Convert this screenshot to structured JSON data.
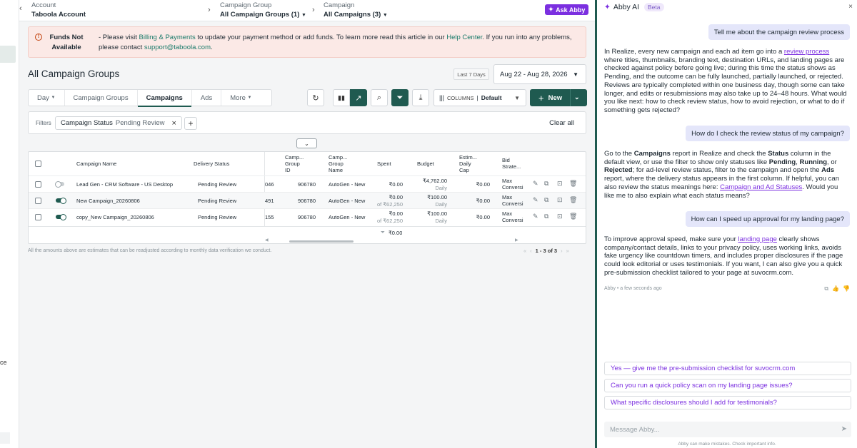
{
  "leftnav": {
    "partial_text": "ce"
  },
  "topbar": {
    "account_label": "Account",
    "account_value": "Taboola Account",
    "group_label": "Campaign Group",
    "group_value": "All Campaign Groups (1)",
    "campaign_label": "Campaign",
    "campaign_value": "All Campaigns (3)",
    "ask_abby": "Ask Abby"
  },
  "alert": {
    "title": "Funds Not Available",
    "msg_pre": "- Please visit ",
    "link1": "Billing & Payments",
    "msg_mid": " to update your payment method or add funds. To learn more read this article in our ",
    "link2": "Help Center",
    "msg_post": ". If you run into any problems, please contact ",
    "link3": "support@taboola.com",
    "msg_end": "."
  },
  "page": {
    "title": "All Campaign Groups",
    "last7": "Last 7 Days",
    "date_range": "Aug 22 - Aug 28, 2026"
  },
  "tabs": [
    "Day",
    "Campaign Groups",
    "Campaigns",
    "Ads",
    "More"
  ],
  "columns": {
    "label": "COLUMNS",
    "value": "Default"
  },
  "new_btn": "New",
  "filters": {
    "label": "Filters",
    "chip_key": "Campaign Status",
    "chip_value": "Pending Review",
    "clear": "Clear all"
  },
  "table": {
    "headers": {
      "name": "Campaign Name",
      "delivery": "Delivery Status",
      "gid": "Camp... Group ID",
      "gname": "Camp... Group Name",
      "spent": "Spent",
      "budget": "Budget",
      "daily": "Estim... Daily Cap",
      "bid": "Bid Strate..."
    },
    "rows": [
      {
        "name": "Lead Gen - CRM Software - US Desktop",
        "delivery": "Pending Review",
        "id": "046",
        "gid": "906780",
        "gname": "AutoGen - New",
        "spent": "₹0.00",
        "spent_sub": "",
        "budget": "₹4,762.00",
        "budget_sub": "Daily",
        "daily": "₹0.00",
        "bid": "Max Conversions"
      },
      {
        "name": "New Campaign_20260806",
        "delivery": "Pending Review",
        "id": "491",
        "gid": "906780",
        "gname": "AutoGen - New",
        "spent": "₹0.00",
        "spent_sub": "of ₹62,250",
        "budget": "₹100.00",
        "budget_sub": "Daily",
        "daily": "₹0.00",
        "bid": "Max Conversions"
      },
      {
        "name": "copy_New Campaign_20260806",
        "delivery": "Pending Review",
        "id": "155",
        "gid": "906780",
        "gname": "AutoGen - New",
        "spent": "₹0.00",
        "spent_sub": "of ₹62,250",
        "budget": "₹100.00",
        "budget_sub": "Daily",
        "daily": "₹0.00",
        "bid": "Max Conversions"
      }
    ],
    "total_spent": "₹0.00"
  },
  "footnote": "All the amounts above are estimates that can be readjusted according to monthly data verification we conduct.",
  "pager": {
    "text": "1 - 3 of 3"
  },
  "chat": {
    "title": "Abby AI",
    "beta": "Beta",
    "u1": "Tell me about the campaign review process",
    "a1_pre": "In Realize, every new campaign and each ad item go into a ",
    "a1_link": "review process",
    "a1_post": " where titles, thumbnails, branding text, destination URLs, and landing pages are checked against policy before going live; during this time the status shows as Pending, and the outcome can be fully launched, partially launched, or rejected. Reviews are typically completed within one business day, though some can take longer, and edits or resubmissions may also take up to 24–48 hours. What would you like next: how to check review status, how to avoid rejection, or what to do if something gets rejected?",
    "u2": "How do I check the review status of my campaign?",
    "a2_1": "Go to the ",
    "a2_b1": "Campaigns",
    "a2_2": " report in Realize and check the ",
    "a2_b2": "Status",
    "a2_3": " column in the default view, or use the filter to show only statuses like ",
    "a2_b3": "Pending",
    "a2_4": ", ",
    "a2_b4": "Running",
    "a2_5": ", or ",
    "a2_b5": "Rejected",
    "a2_6": "; for ad-level review status, filter to the campaign and open the ",
    "a2_b6": "Ads",
    "a2_7": " report, where the delivery status appears in the first column. If helpful, you can also review the status meanings here: ",
    "a2_link": "Campaign and Ad Statuses",
    "a2_8": ". Would you like me to also explain what each status means?",
    "u3": "How can I speed up approval for my landing page?",
    "a3_pre": "To improve approval speed, make sure your ",
    "a3_link": "landing page",
    "a3_post": " clearly shows company/contact details, links to your privacy policy, uses working links, avoids fake urgency like countdown timers, and includes proper disclosures if the page could look editorial or uses testimonials. If you want, I can also give you a quick pre-submission checklist tailored to your page at suvocrm.com.",
    "meta": "Abby • a few seconds ago",
    "suggestions": [
      "Yes — give me the pre-submission checklist for suvocrm.com",
      "Can you run a quick policy scan on my landing page issues?",
      "What specific disclosures should I add for testimonials?"
    ],
    "input_placeholder": "Message Abby...",
    "disclaimer": "Abby can make mistakes. Check important info."
  }
}
